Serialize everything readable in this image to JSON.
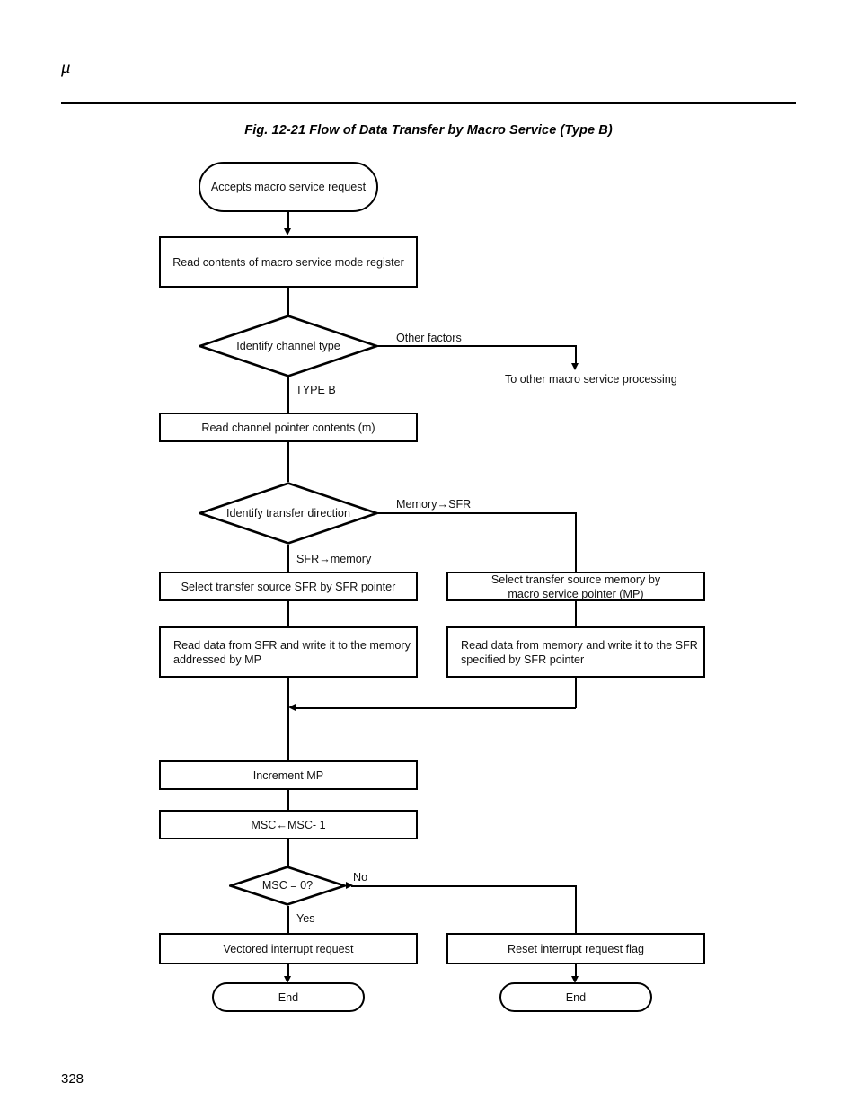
{
  "header": {
    "mu_symbol": "μ"
  },
  "figure": {
    "title": "Fig. 12-21  Flow of Data Transfer by Macro Service (Type B)"
  },
  "footer": {
    "page_number": "328"
  },
  "flowchart": {
    "nodes": {
      "start": "Accepts macro service request",
      "read_mode_register": "Read contents of macro service mode register",
      "identify_channel_type": "Identify channel type",
      "read_channel_pointer": "Read channel pointer contents (m)",
      "identify_transfer_direction": "Identify transfer direction",
      "select_source_sfr": "Select transfer source SFR by SFR pointer",
      "select_source_memory_line1": "Select transfer source memory by",
      "select_source_memory_line2": "macro service pointer (MP)",
      "read_sfr_write_memory_line1": "Read data from SFR and write it to the memory",
      "read_sfr_write_memory_line2": "addressed by MP",
      "read_memory_write_sfr_line1": "Read data from memory and write it to the SFR",
      "read_memory_write_sfr_line2": "specified by SFR pointer",
      "increment_mp": "Increment MP",
      "decrement_msc": "MSC←MSC- 1",
      "msc_zero_check": "MSC = 0?",
      "vectored_interrupt": "Vectored interrupt request",
      "reset_interrupt_flag": "Reset interrupt request flag",
      "end_left": "End",
      "end_right": "End"
    },
    "edge_labels": {
      "other_factors": "Other factors",
      "type_b": "TYPE B",
      "memory_to_sfr": "Memory→SFR",
      "sfr_to_memory": "SFR→memory",
      "no": "No",
      "yes": "Yes"
    },
    "notes": {
      "to_other_processing": "To other macro service processing"
    }
  }
}
